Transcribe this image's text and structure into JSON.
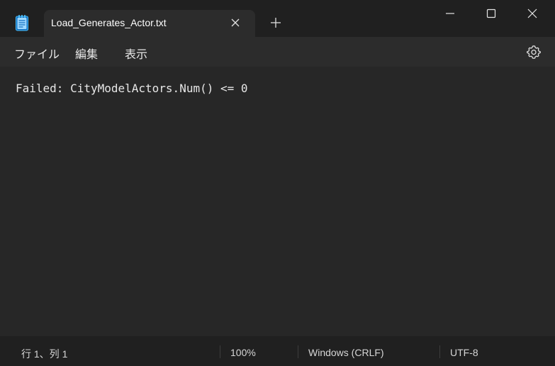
{
  "tab": {
    "title": "Load_Generates_Actor.txt"
  },
  "menu": {
    "file": "ファイル",
    "edit": "編集",
    "view": "表示"
  },
  "editor": {
    "content": "Failed: CityModelActors.Num() <= 0"
  },
  "status": {
    "position": "行 1、列 1",
    "zoom": "100%",
    "line_ending": "Windows (CRLF)",
    "encoding": "UTF-8"
  },
  "icons": {
    "app": "notepad-icon",
    "tab_close": "close-icon",
    "new_tab": "plus-icon",
    "minimize": "minimize-icon",
    "maximize": "maximize-icon",
    "close": "close-icon",
    "settings": "gear-icon"
  },
  "colors": {
    "titlebar_bg": "#202020",
    "tab_bg": "#2c2c2c",
    "editor_bg": "#272727",
    "text": "#e6e6e6",
    "app_icon": "#4cc2ff"
  }
}
